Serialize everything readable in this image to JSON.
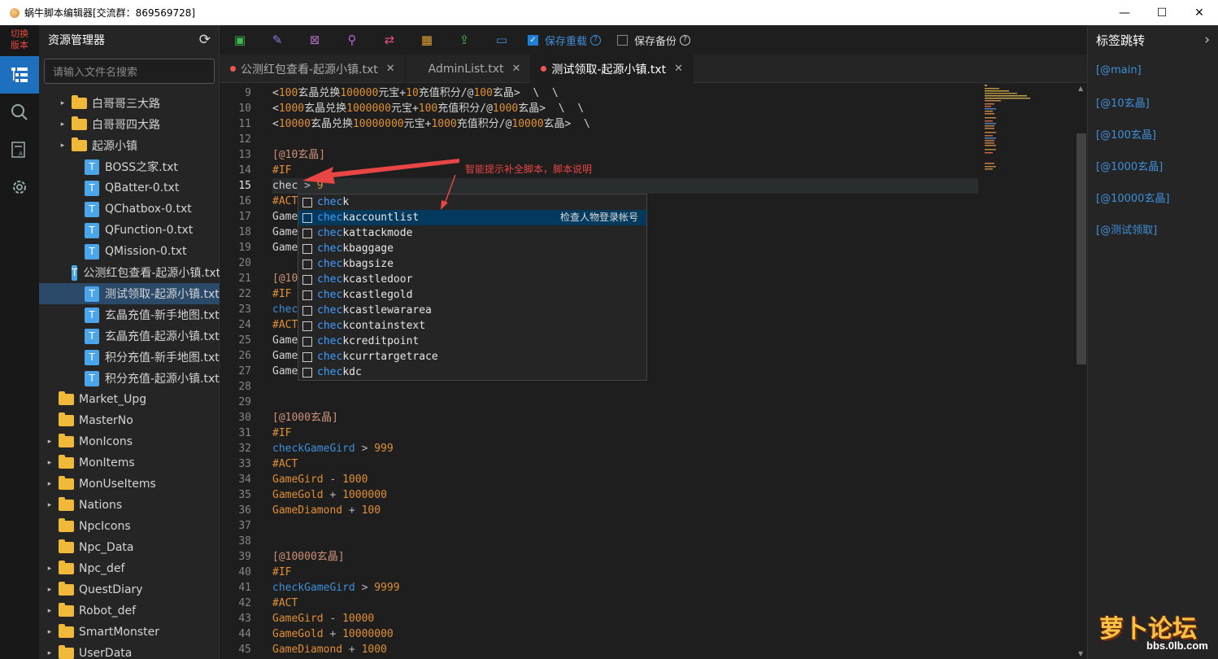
{
  "window": {
    "title": "蜗牛脚本编辑器[交流群：869569728]",
    "minimize": "—",
    "maximize": "☐",
    "close": "✕"
  },
  "leftnav": {
    "switch_label": "切换\n版本",
    "icons": [
      "explorer-icon",
      "search-icon",
      "text-icon",
      "settings-icon"
    ]
  },
  "sidebar": {
    "title": "资源管理器",
    "search_placeholder": "请输入文件名搜索",
    "tree": [
      {
        "label": "白哥哥三大路",
        "type": "folder",
        "arrow": "▸",
        "indent": 1
      },
      {
        "label": "白哥哥四大路",
        "type": "folder",
        "arrow": "▸",
        "indent": 1
      },
      {
        "label": "起源小镇",
        "type": "folder",
        "arrow": "▸",
        "indent": 1
      },
      {
        "label": "BOSS之家.txt",
        "type": "file",
        "arrow": "",
        "indent": 2
      },
      {
        "label": "QBatter-0.txt",
        "type": "file",
        "arrow": "",
        "indent": 2
      },
      {
        "label": "QChatbox-0.txt",
        "type": "file",
        "arrow": "",
        "indent": 2
      },
      {
        "label": "QFunction-0.txt",
        "type": "file",
        "arrow": "",
        "indent": 2
      },
      {
        "label": "QMission-0.txt",
        "type": "file",
        "arrow": "",
        "indent": 2
      },
      {
        "label": "公测红包查看-起源小镇.txt",
        "type": "file",
        "arrow": "",
        "indent": 2
      },
      {
        "label": "测试领取-起源小镇.txt",
        "type": "file",
        "arrow": "",
        "indent": 2,
        "selected": true
      },
      {
        "label": "玄晶充值-新手地图.txt",
        "type": "file",
        "arrow": "",
        "indent": 2
      },
      {
        "label": "玄晶充值-起源小镇.txt",
        "type": "file",
        "arrow": "",
        "indent": 2
      },
      {
        "label": "积分充值-新手地图.txt",
        "type": "file",
        "arrow": "",
        "indent": 2
      },
      {
        "label": "积分充值-起源小镇.txt",
        "type": "file",
        "arrow": "",
        "indent": 2
      },
      {
        "label": "Market_Upg",
        "type": "folder",
        "arrow": "",
        "indent": 0
      },
      {
        "label": "MasterNo",
        "type": "folder",
        "arrow": "",
        "indent": 0
      },
      {
        "label": "MonIcons",
        "type": "folder",
        "arrow": "▸",
        "indent": 0
      },
      {
        "label": "MonItems",
        "type": "folder",
        "arrow": "▸",
        "indent": 0
      },
      {
        "label": "MonUseItems",
        "type": "folder",
        "arrow": "▸",
        "indent": 0
      },
      {
        "label": "Nations",
        "type": "folder",
        "arrow": "▸",
        "indent": 0
      },
      {
        "label": "NpcIcons",
        "type": "folder",
        "arrow": "",
        "indent": 0
      },
      {
        "label": "Npc_Data",
        "type": "folder",
        "arrow": "",
        "indent": 0
      },
      {
        "label": "Npc_def",
        "type": "folder",
        "arrow": "▸",
        "indent": 0
      },
      {
        "label": "QuestDiary",
        "type": "folder",
        "arrow": "▸",
        "indent": 0
      },
      {
        "label": "Robot_def",
        "type": "folder",
        "arrow": "▸",
        "indent": 0
      },
      {
        "label": "SmartMonster",
        "type": "folder",
        "arrow": "▸",
        "indent": 0
      },
      {
        "label": "UserData",
        "type": "folder",
        "arrow": "▸",
        "indent": 0
      }
    ]
  },
  "toolbar": {
    "icons": [
      {
        "name": "save-icon",
        "glyph": "▣",
        "color": "#3fb950"
      },
      {
        "name": "edit-icon",
        "glyph": "✎",
        "color": "#8a7be0"
      },
      {
        "name": "close-file-icon",
        "glyph": "⊠",
        "color": "#b06cc0"
      },
      {
        "name": "find-icon",
        "glyph": "⚲",
        "color": "#b565d8"
      },
      {
        "name": "replace-icon",
        "glyph": "⇄",
        "color": "#e0507a"
      },
      {
        "name": "qrcode-icon",
        "glyph": "▦",
        "color": "#e0a030"
      },
      {
        "name": "upload-icon",
        "glyph": "⇪",
        "color": "#3fb950"
      },
      {
        "name": "folder-open-icon",
        "glyph": "▭",
        "color": "#3f8fd8"
      }
    ],
    "save_reload": "保存重载",
    "save_backup": "保存备份"
  },
  "tabs": [
    {
      "label": "公测红包查看-起源小镇.txt",
      "dot": true,
      "active": false
    },
    {
      "label": "AdminList.txt",
      "dot": false,
      "active": false
    },
    {
      "label": "测试领取-起源小镇.txt",
      "dot": true,
      "active": true
    }
  ],
  "code": [
    {
      "n": "9",
      "t": [
        [
          "<",
          "w"
        ],
        [
          "100",
          "n"
        ],
        [
          "玄晶兑换",
          "w"
        ],
        [
          "100000",
          "n"
        ],
        [
          "元宝+",
          "w"
        ],
        [
          "10",
          "n"
        ],
        [
          "充值积分/@",
          "w"
        ],
        [
          "100",
          "n"
        ],
        [
          "玄晶>  \\  \\",
          "w"
        ]
      ]
    },
    {
      "n": "10",
      "t": [
        [
          "<",
          "w"
        ],
        [
          "1000",
          "n"
        ],
        [
          "玄晶兑换",
          "w"
        ],
        [
          "1000000",
          "n"
        ],
        [
          "元宝+",
          "w"
        ],
        [
          "100",
          "n"
        ],
        [
          "充值积分/@",
          "w"
        ],
        [
          "1000",
          "n"
        ],
        [
          "玄晶>  \\  \\",
          "w"
        ]
      ]
    },
    {
      "n": "11",
      "t": [
        [
          "<",
          "w"
        ],
        [
          "10000",
          "n"
        ],
        [
          "玄晶兑换",
          "w"
        ],
        [
          "10000000",
          "n"
        ],
        [
          "元宝+",
          "w"
        ],
        [
          "1000",
          "n"
        ],
        [
          "充值积分/@",
          "w"
        ],
        [
          "10000",
          "n"
        ],
        [
          "玄晶>  \\",
          "w"
        ]
      ]
    },
    {
      "n": "12",
      "t": []
    },
    {
      "n": "13",
      "t": [
        [
          "[@10玄晶]",
          "o"
        ]
      ]
    },
    {
      "n": "14",
      "t": [
        [
          "#IF",
          "r"
        ]
      ]
    },
    {
      "n": "15",
      "t": [
        [
          "chec",
          "w"
        ],
        [
          " > ",
          "g"
        ],
        [
          "9",
          "n"
        ]
      ]
    },
    {
      "n": "16",
      "t": [
        [
          "#ACT",
          "r"
        ]
      ]
    },
    {
      "n": "17",
      "t": [
        [
          "Game",
          "w"
        ]
      ]
    },
    {
      "n": "18",
      "t": [
        [
          "Game",
          "w"
        ]
      ]
    },
    {
      "n": "19",
      "t": [
        [
          "Game",
          "w"
        ]
      ]
    },
    {
      "n": "20",
      "t": []
    },
    {
      "n": "21",
      "t": [
        [
          "[@10",
          "o"
        ]
      ]
    },
    {
      "n": "22",
      "t": [
        [
          "#IF",
          "r"
        ]
      ]
    },
    {
      "n": "23",
      "t": [
        [
          "chec",
          "b"
        ]
      ]
    },
    {
      "n": "24",
      "t": [
        [
          "#ACT",
          "r"
        ]
      ]
    },
    {
      "n": "25",
      "t": [
        [
          "Game",
          "w"
        ]
      ]
    },
    {
      "n": "26",
      "t": [
        [
          "Game",
          "w"
        ]
      ]
    },
    {
      "n": "27",
      "t": [
        [
          "Game",
          "w"
        ]
      ]
    },
    {
      "n": "28",
      "t": []
    },
    {
      "n": "29",
      "t": []
    },
    {
      "n": "30",
      "t": [
        [
          "[@1000玄晶]",
          "o"
        ]
      ]
    },
    {
      "n": "31",
      "t": [
        [
          "#IF",
          "r"
        ]
      ]
    },
    {
      "n": "32",
      "t": [
        [
          "checkGameGird",
          "b"
        ],
        [
          " > ",
          "g"
        ],
        [
          "999",
          "n"
        ]
      ]
    },
    {
      "n": "33",
      "t": [
        [
          "#ACT",
          "r"
        ]
      ]
    },
    {
      "n": "34",
      "t": [
        [
          "GameGird",
          "n"
        ],
        [
          " - ",
          "g"
        ],
        [
          "1000",
          "n"
        ]
      ]
    },
    {
      "n": "35",
      "t": [
        [
          "GameGold",
          "n"
        ],
        [
          " + ",
          "g"
        ],
        [
          "1000000",
          "n"
        ]
      ]
    },
    {
      "n": "36",
      "t": [
        [
          "GameDiamond",
          "n"
        ],
        [
          " + ",
          "g"
        ],
        [
          "100",
          "n"
        ]
      ]
    },
    {
      "n": "37",
      "t": []
    },
    {
      "n": "38",
      "t": []
    },
    {
      "n": "39",
      "t": [
        [
          "[@10000玄晶]",
          "o"
        ]
      ]
    },
    {
      "n": "40",
      "t": [
        [
          "#IF",
          "r"
        ]
      ]
    },
    {
      "n": "41",
      "t": [
        [
          "checkGameGird",
          "b"
        ],
        [
          " > ",
          "g"
        ],
        [
          "9999",
          "n"
        ]
      ]
    },
    {
      "n": "42",
      "t": [
        [
          "#ACT",
          "r"
        ]
      ]
    },
    {
      "n": "43",
      "t": [
        [
          "GameGird",
          "n"
        ],
        [
          " - ",
          "g"
        ],
        [
          "10000",
          "n"
        ]
      ]
    },
    {
      "n": "44",
      "t": [
        [
          "GameGold",
          "n"
        ],
        [
          " + ",
          "g"
        ],
        [
          "10000000",
          "n"
        ]
      ]
    },
    {
      "n": "45",
      "t": [
        [
          "GameDiamond",
          "n"
        ],
        [
          " + ",
          "g"
        ],
        [
          "1000",
          "n"
        ]
      ]
    }
  ],
  "suggest": {
    "match": "chec",
    "items": [
      {
        "rest": "k",
        "desc": ""
      },
      {
        "rest": "kaccountlist",
        "desc": "检查人物登录帐号",
        "selected": true
      },
      {
        "rest": "kattackmode",
        "desc": ""
      },
      {
        "rest": "kbaggage",
        "desc": ""
      },
      {
        "rest": "kbagsize",
        "desc": ""
      },
      {
        "rest": "kcastledoor",
        "desc": ""
      },
      {
        "rest": "kcastlegold",
        "desc": ""
      },
      {
        "rest": "kcastlewararea",
        "desc": ""
      },
      {
        "rest": "kcontainstext",
        "desc": ""
      },
      {
        "rest": "kcreditpoint",
        "desc": ""
      },
      {
        "rest": "kcurrtargetrace",
        "desc": ""
      },
      {
        "rest": "kdc",
        "desc": ""
      }
    ]
  },
  "annotation": "智能提示补全脚本，脚本说明",
  "rightpanel": {
    "title": "标签跳转",
    "items": [
      "[@main]",
      "[@10玄晶]",
      "[@100玄晶]",
      "[@1000玄晶]",
      "[@10000玄晶]",
      "[@测试领取]"
    ]
  },
  "watermark": {
    "big": "萝卜论坛",
    "small": "bbs.0lb.com"
  }
}
